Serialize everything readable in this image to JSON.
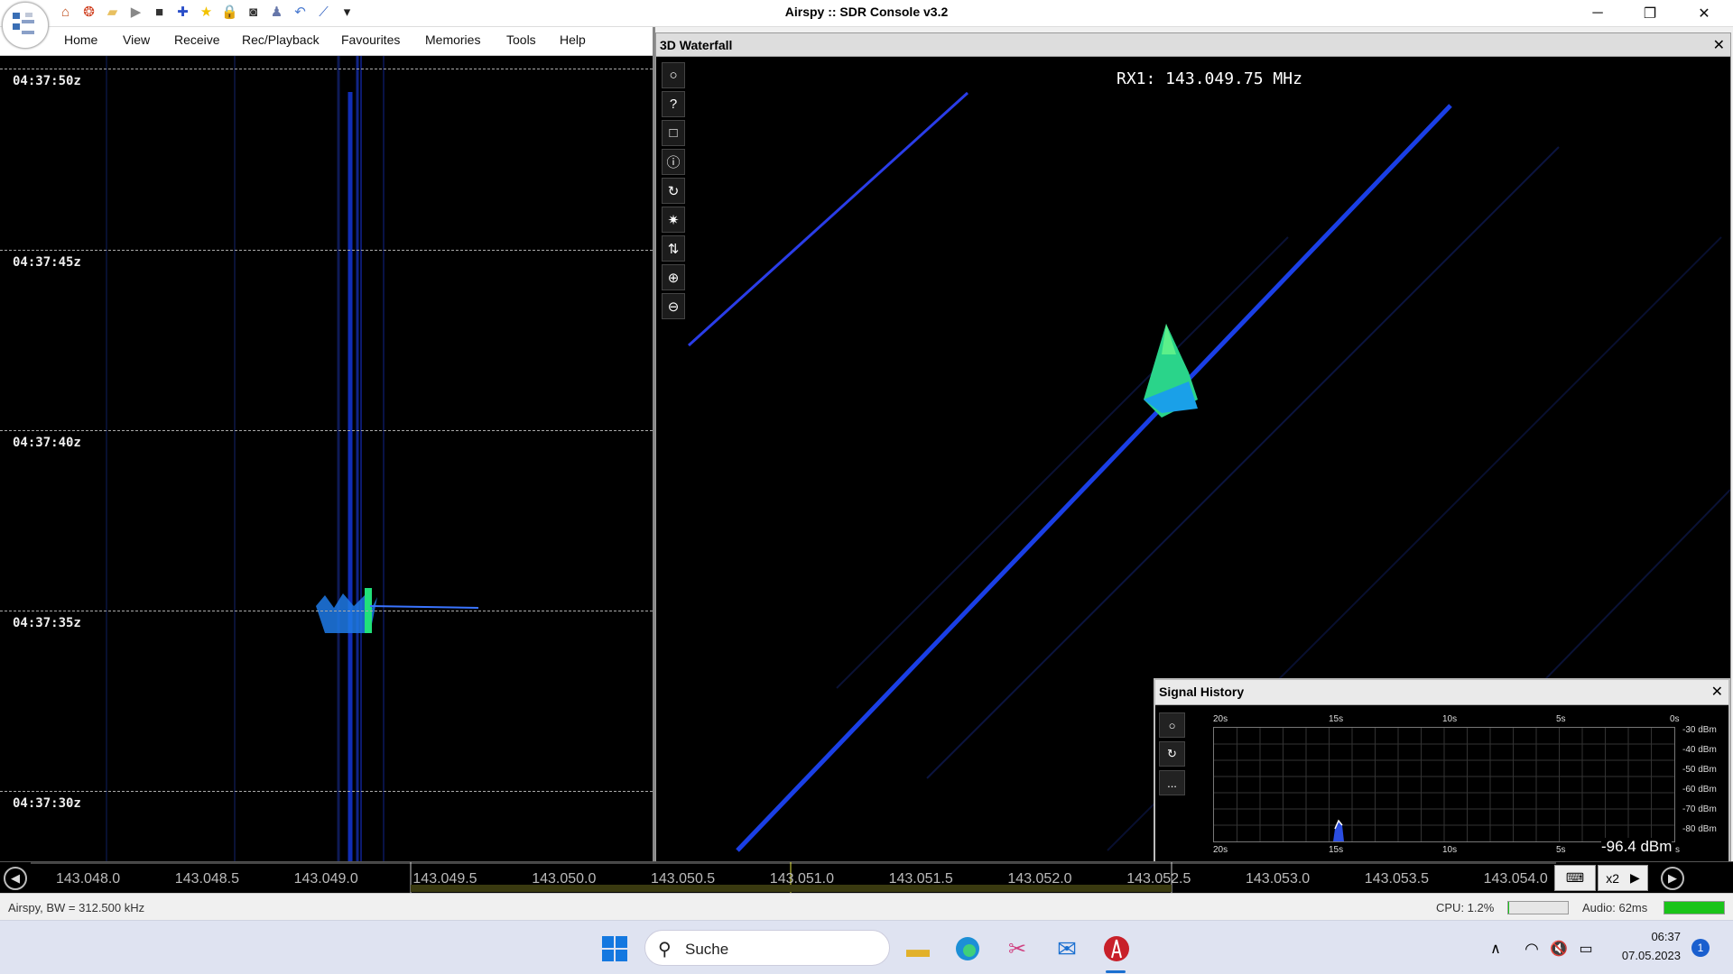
{
  "window": {
    "title": "Airspy :: SDR Console v3.2"
  },
  "quick_toolbar": [
    {
      "name": "home-icon",
      "glyph": "⌂",
      "color": "#c05020"
    },
    {
      "name": "help-lifebuoy-icon",
      "glyph": "❂",
      "color": "#d04020"
    },
    {
      "name": "open-folder-icon",
      "glyph": "▰",
      "color": "#e8c060"
    },
    {
      "name": "play-icon",
      "glyph": "▶",
      "color": "#888888"
    },
    {
      "name": "stop-icon",
      "glyph": "■",
      "color": "#333333"
    },
    {
      "name": "add-icon",
      "glyph": "✚",
      "color": "#2b4fc9"
    },
    {
      "name": "favourite-star-icon",
      "glyph": "★",
      "color": "#f2c200"
    },
    {
      "name": "lock-icon",
      "glyph": "🔒",
      "color": "#d4a000"
    },
    {
      "name": "camera-icon",
      "glyph": "◙",
      "color": "#333333"
    },
    {
      "name": "user-icon",
      "glyph": "♟",
      "color": "#6677aa"
    },
    {
      "name": "undo-icon",
      "glyph": "↶",
      "color": "#4a7ad0"
    },
    {
      "name": "chart-tool-icon",
      "glyph": "⟋",
      "color": "#3060c0"
    },
    {
      "name": "toolbar-dropdown-icon",
      "glyph": "▾",
      "color": "#222222"
    }
  ],
  "menu": [
    "Home",
    "View",
    "Receive",
    "Rec/Playback",
    "Favourites",
    "Memories",
    "Tools",
    "Help"
  ],
  "left_waterfall": {
    "time_labels": [
      "04:37:50z",
      "04:37:45z",
      "04:37:40z",
      "04:37:35z",
      "04:37:30z"
    ]
  },
  "waterfall3d": {
    "title": "3D Waterfall",
    "rx_label": "RX1: 143.049.75 MHz",
    "tools": [
      {
        "name": "options-circle-icon",
        "glyph": "○"
      },
      {
        "name": "help-question-icon",
        "glyph": "?"
      },
      {
        "name": "square-view-icon",
        "glyph": "□"
      },
      {
        "name": "info-icon",
        "glyph": "ⓘ"
      },
      {
        "name": "rotate-icon",
        "glyph": "↻"
      },
      {
        "name": "brightness-icon",
        "glyph": "✷"
      },
      {
        "name": "swap-vertical-icon",
        "glyph": "⇅"
      },
      {
        "name": "zoom-in-icon",
        "glyph": "⊕"
      },
      {
        "name": "zoom-out-icon",
        "glyph": "⊖"
      }
    ]
  },
  "signal_history": {
    "title": "Signal History",
    "tools": [
      {
        "name": "signal-options-icon",
        "glyph": "○"
      },
      {
        "name": "signal-refresh-icon",
        "glyph": "↻"
      },
      {
        "name": "signal-more-icon",
        "glyph": "..."
      }
    ],
    "x_top_labels": [
      "20s",
      "15s",
      "10s",
      "5s",
      "0s"
    ],
    "x_bottom_labels": [
      "20s",
      "15s",
      "10s",
      "5s",
      "s"
    ],
    "y_labels": [
      "-30 dBm",
      "-40 dBm",
      "-50 dBm",
      "-60 dBm",
      "-70 dBm",
      "-80 dBm"
    ],
    "current_value": "-96.4 dBm"
  },
  "frequency_scale": {
    "labels": [
      "143.048.0",
      "143.048.5",
      "143.049.0",
      "143.049.5",
      "143.050.0",
      "143.050.5",
      "143.051.0",
      "143.051.5",
      "143.052.0",
      "143.052.5",
      "143.053.0",
      "143.053.5",
      "143.054.0"
    ],
    "zoom": "x2"
  },
  "status_bar": {
    "left": "Airspy, BW = 312.500 kHz",
    "cpu": "CPU: 1.2%",
    "cpu_level": 0.012,
    "audio": "Audio: 62ms",
    "audio_level": 1.0
  },
  "taskbar": {
    "search_label": "Suche",
    "time": "06:37",
    "date": "07.05.2023",
    "notification_count": "1"
  }
}
